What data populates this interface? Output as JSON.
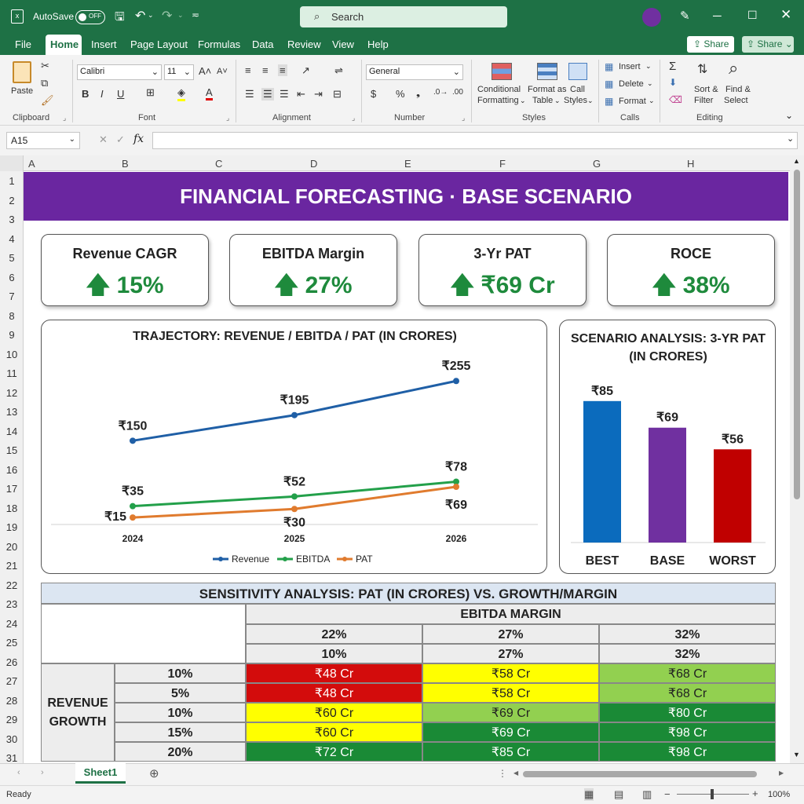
{
  "titlebar": {
    "autosave": "AutoSave",
    "toggle": "OFF",
    "search": "Search"
  },
  "tabs": [
    "File",
    "Home",
    "Insert",
    "Page Layout",
    "Formulas",
    "Data",
    "Review",
    "View",
    "Help"
  ],
  "share": {
    "share1": "Share",
    "share2": "Share"
  },
  "ribbon": {
    "clipboard": {
      "paste": "Paste",
      "group": "Clipboard"
    },
    "font": {
      "name": "Calibri",
      "size": "11",
      "group": "Font"
    },
    "alignment": {
      "group": "Alignment"
    },
    "number": {
      "format": "General",
      "group": "Number"
    },
    "styles": {
      "conditional": [
        "Conditional",
        "Formatting"
      ],
      "format_table": [
        "Format as",
        "Table"
      ],
      "cell_styles": [
        "Call",
        "Styles"
      ],
      "group": "Styles"
    },
    "cells": {
      "insert": "Insert",
      "delete": "Delete",
      "format": "Format",
      "group": "Calls"
    },
    "editing": {
      "sort": [
        "Sort &",
        "Filter"
      ],
      "find": [
        "Find &",
        "Select"
      ],
      "group": "Editing"
    }
  },
  "namebox": "A15",
  "columns": [
    "A",
    "B",
    "C",
    "D",
    "E",
    "F",
    "G",
    "H"
  ],
  "rows": [
    "1",
    "2",
    "3",
    "4",
    "5",
    "6",
    "7",
    "8",
    "9",
    "10",
    "11",
    "12",
    "13",
    "14",
    "15",
    "16",
    "17",
    "18",
    "19",
    "20",
    "21",
    "22",
    "23",
    "24",
    "25",
    "26",
    "27",
    "28",
    "29",
    "30",
    "31"
  ],
  "banner": "FINANCIAL FORECASTING · BASE SCENARIO",
  "kpis": [
    {
      "title": "Revenue CAGR",
      "value": "15%"
    },
    {
      "title": "EBITDA Margin",
      "value": "27%"
    },
    {
      "title": "3-Yr PAT",
      "value": "₹69 Cr"
    },
    {
      "title": "ROCE",
      "value": "38%"
    }
  ],
  "colors": {
    "green": "#1e8a3c",
    "purple": "#6a26a0",
    "revenue": "#1f5fa6",
    "ebitda": "#23a04a",
    "pat": "#e07b2e",
    "best": "#0b6bbd",
    "base": "#7030a0",
    "worst": "#c00000"
  },
  "chart_data": [
    {
      "type": "line",
      "title": "TRAJECTORY: REVENUE / EBITDA / PAT (IN CRORES)",
      "categories": [
        "2024",
        "2025",
        "2026"
      ],
      "series": [
        {
          "name": "Revenue",
          "values": [
            150,
            195,
            255
          ],
          "labels": [
            "₹150",
            "₹195",
            "₹255"
          ]
        },
        {
          "name": "EBITDA",
          "values": [
            35,
            52,
            78
          ],
          "labels": [
            "₹35",
            "₹52",
            "₹78"
          ]
        },
        {
          "name": "PAT",
          "values": [
            15,
            30,
            69
          ],
          "labels": [
            "₹15",
            "₹30",
            "₹69"
          ]
        }
      ],
      "legend": "bottom"
    },
    {
      "type": "bar",
      "title": "SCENARIO ANALYSIS: 3-YR PAT (IN CRORES)",
      "categories": [
        "BEST",
        "BASE",
        "WORST"
      ],
      "values": [
        85,
        69,
        56
      ],
      "labels": [
        "₹85",
        "₹69",
        "₹56"
      ],
      "ylim": [
        0,
        100
      ]
    }
  ],
  "sensitivity": {
    "title": "SENSITIVITY ANALYSIS: PAT (IN CRORES) VS. GROWTH/MARGIN",
    "col_header": "EBITDA MARGIN",
    "margins1": [
      "22%",
      "27%",
      "32%"
    ],
    "margins2": [
      "10%",
      "27%",
      "32%"
    ],
    "row_header": [
      "REVENUE",
      "GROWTH"
    ],
    "growth": [
      "10%",
      "5%",
      "10%",
      "15%",
      "20%"
    ],
    "values": [
      [
        "₹48 Cr",
        "₹58 Cr",
        "₹68 Cr"
      ],
      [
        "₹48 Cr",
        "₹58 Cr",
        "₹68 Cr"
      ],
      [
        "₹60 Cr",
        "₹69 Cr",
        "₹80 Cr"
      ],
      [
        "₹60 Cr",
        "₹69 Cr",
        "₹98 Cr"
      ],
      [
        "₹72 Cr",
        "₹85 Cr",
        "₹98 Cr"
      ]
    ],
    "fills": [
      [
        "#d30c0c",
        "#ffff00",
        "#92d050"
      ],
      [
        "#d30c0c",
        "#ffff00",
        "#92d050"
      ],
      [
        "#ffff00",
        "#92d050",
        "#1a8a36"
      ],
      [
        "#ffff00",
        "#1a8a36",
        "#1a8a36"
      ],
      [
        "#1a8a36",
        "#1a8a36",
        "#1a8a36"
      ]
    ]
  },
  "sheet": "Sheet1",
  "status": {
    "ready": "Ready",
    "zoom": "100%"
  }
}
